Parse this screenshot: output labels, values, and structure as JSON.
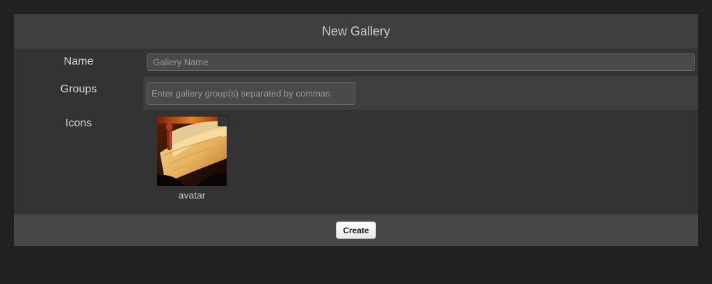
{
  "panel": {
    "title": "New Gallery"
  },
  "form": {
    "name_label": "Name",
    "name_placeholder": "Gallery Name",
    "name_value": "",
    "groups_label": "Groups",
    "groups_placeholder": "Enter gallery group(s) separated by commas",
    "groups_value": "",
    "icons_label": "Icons"
  },
  "icons": [
    {
      "caption": "avatar",
      "selected": false
    }
  ],
  "footer": {
    "create_label": "Create"
  },
  "colors": {
    "page_bg": "#212121",
    "panel_bg": "#3f3f3f",
    "row_dark_bg": "#333333",
    "footer_bg": "#474747",
    "title_text": "#c9c9c9"
  },
  "icon_names": {
    "thumbnail": "book-photo-icon",
    "checkbox": "checkbox-icon"
  }
}
